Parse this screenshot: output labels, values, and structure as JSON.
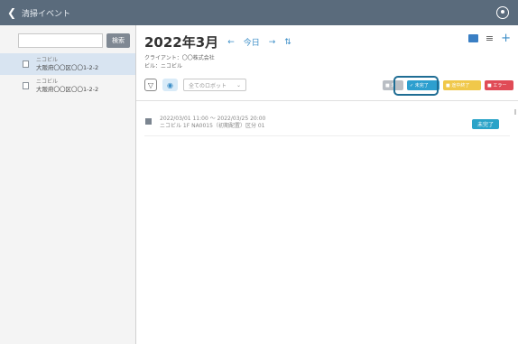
{
  "topbar": {
    "title": "清掃イベント",
    "back_icon": "chevron-left-icon",
    "user_icon": "user-circle-icon"
  },
  "sidebar": {
    "search": {
      "value": "",
      "placeholder": "",
      "button_label": "検索"
    },
    "items": [
      {
        "line1": "ニコビル",
        "line2": "大阪府〇〇区〇〇1-2-2",
        "active": true
      },
      {
        "line1": "ニコビル",
        "line2": "大阪府〇〇区〇〇1-2-2",
        "active": false
      }
    ]
  },
  "main": {
    "month": "2022年3月",
    "prev": "←",
    "today": "今日",
    "next": "→",
    "sort": "⇅",
    "client": "クライアント：〇〇株式会社",
    "building": "ビル：ニコビル",
    "robot_select": "全てのロボット",
    "status_filters": {
      "grey": "■ 未",
      "blue": "✓ 未完了",
      "yellow": "■ 途中終了",
      "red": "■ エラー"
    },
    "events": [
      {
        "line1": "2022/03/01 11:00 ～ 2022/03/25 20:00",
        "line2": "ニコビル 1F NA0015（初期配置）区分 01",
        "status": "未完了"
      }
    ]
  },
  "colors": {
    "topbar": "#5a6b7c",
    "accent": "#2d9fcf",
    "highlight": "#1f6d94"
  }
}
